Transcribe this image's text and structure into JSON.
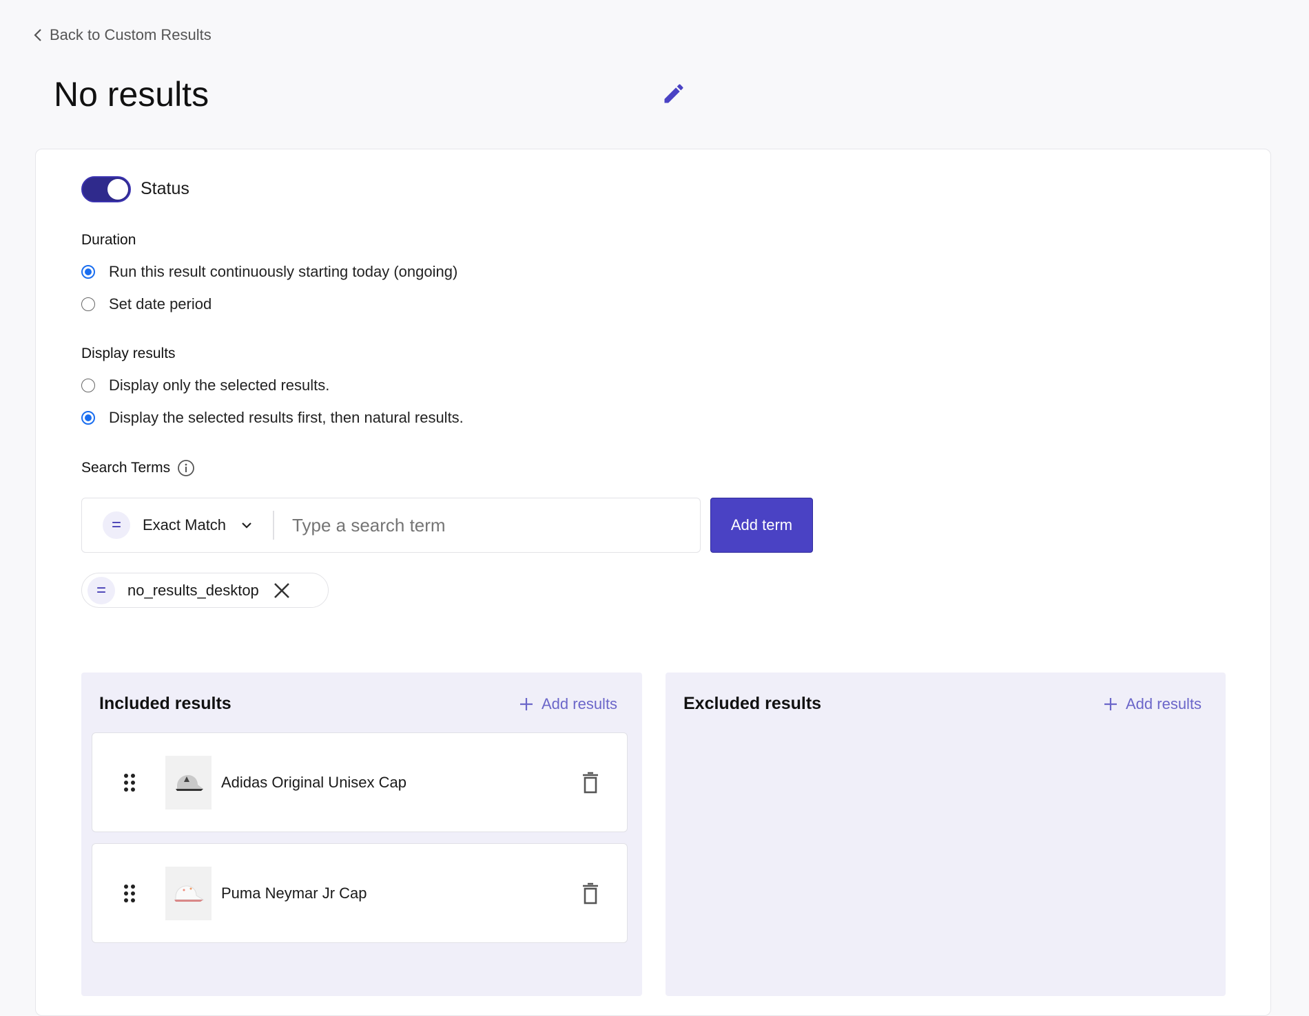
{
  "nav": {
    "back_label": "Back to Custom Results"
  },
  "page": {
    "title": "No results"
  },
  "status": {
    "label": "Status",
    "enabled": true
  },
  "duration": {
    "heading": "Duration",
    "options": [
      {
        "label": "Run this result continuously starting today (ongoing)",
        "selected": true
      },
      {
        "label": "Set date period",
        "selected": false
      }
    ]
  },
  "display": {
    "heading": "Display results",
    "options": [
      {
        "label": "Display only the selected results.",
        "selected": false
      },
      {
        "label": "Display the selected results first, then natural results.",
        "selected": true
      }
    ]
  },
  "search_terms": {
    "heading": "Search Terms",
    "match_type": "Exact Match",
    "match_symbol": "=",
    "placeholder": "Type a search term",
    "add_label": "Add term",
    "terms": [
      {
        "symbol": "=",
        "text": "no_results_desktop"
      }
    ]
  },
  "included": {
    "title": "Included results",
    "add_label": "Add results",
    "items": [
      {
        "name": "Adidas Original Unisex Cap"
      },
      {
        "name": "Puma Neymar Jr Cap"
      }
    ]
  },
  "excluded": {
    "title": "Excluded results",
    "add_label": "Add results",
    "items": []
  },
  "colors": {
    "accent": "#4a42c4",
    "toggle": "#2f2a8c",
    "radio": "#1a6ef0",
    "panel_bg": "#f0eff9"
  }
}
